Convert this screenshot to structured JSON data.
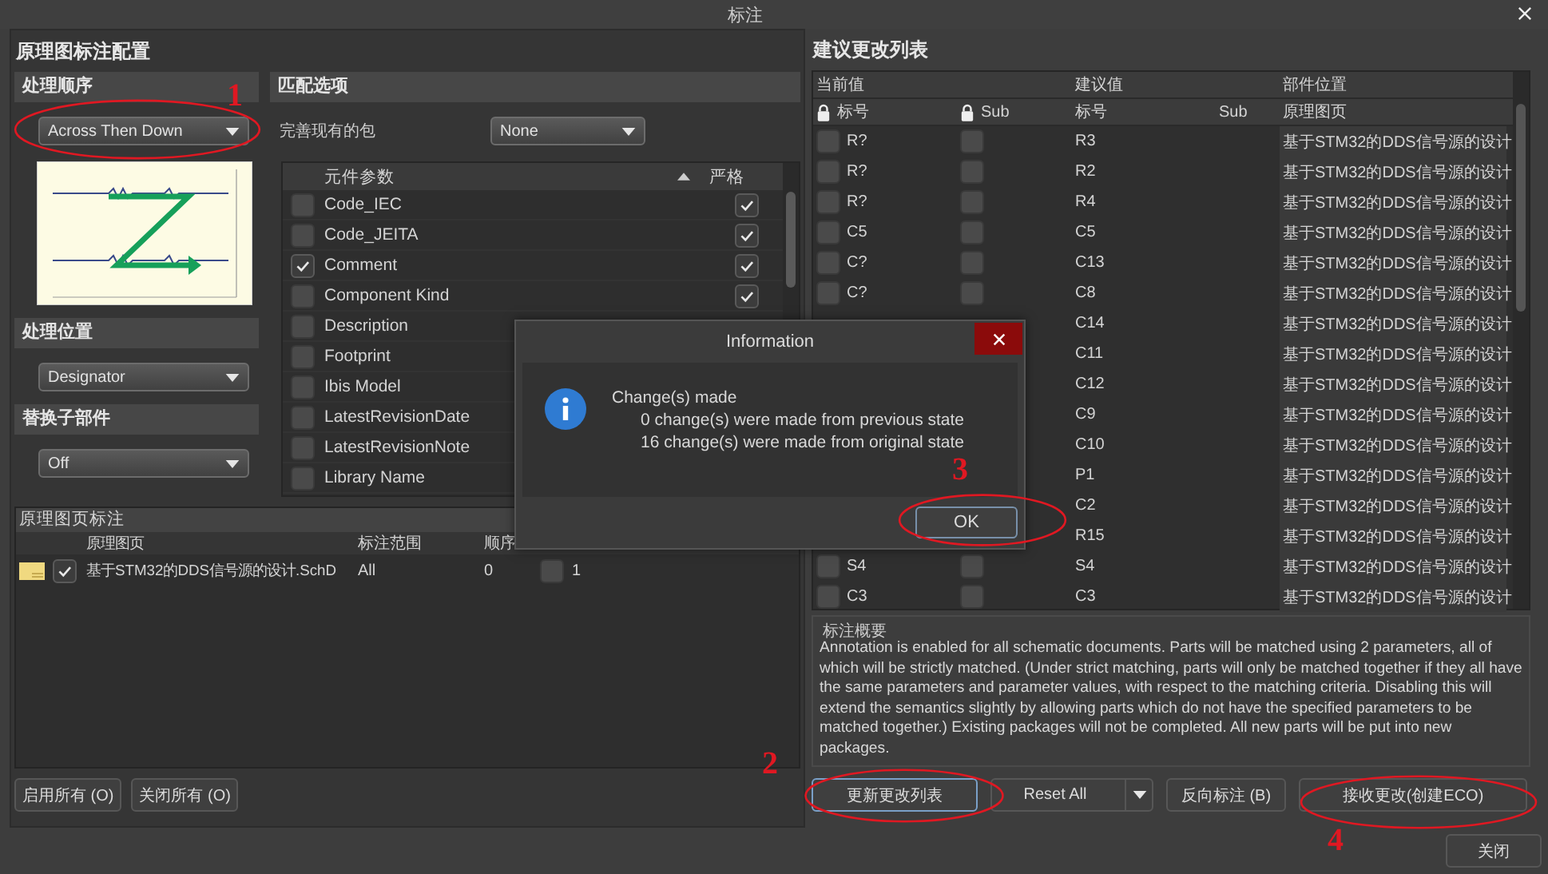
{
  "window": {
    "title": "标注"
  },
  "config": {
    "title": "原理图标注配置",
    "sections": [
      {
        "header": "处理顺序",
        "value": "Across Then Down"
      },
      {
        "header": "处理位置",
        "value": "Designator"
      },
      {
        "header": "替换子部件",
        "value": "Off"
      }
    ],
    "matching": {
      "header": "匹配选项",
      "complete_label": "完善现有的包",
      "complete_value": "None",
      "columns": [
        "元件参数",
        "严格"
      ],
      "params": [
        {
          "name": "Code_IEC",
          "checked": false,
          "strict": true
        },
        {
          "name": "Code_JEITA",
          "checked": false,
          "strict": true
        },
        {
          "name": "Comment",
          "checked": true,
          "strict": true
        },
        {
          "name": "Component Kind",
          "checked": false,
          "strict": true
        },
        {
          "name": "Description",
          "checked": false
        },
        {
          "name": "Footprint",
          "checked": false
        },
        {
          "name": "Ibis Model",
          "checked": false
        },
        {
          "name": "LatestRevisionDate",
          "checked": false
        },
        {
          "name": "LatestRevisionNote",
          "checked": false
        },
        {
          "name": "Library Name",
          "checked": false
        }
      ]
    }
  },
  "sheets": {
    "title": "原理图页标注",
    "columns": [
      "原理图页",
      "标注范围",
      "顺序"
    ],
    "rows": [
      {
        "enabled": true,
        "sheet": "基于STM32的DDS信号源的设计.SchD",
        "scope": "All",
        "order": "0",
        "start_checked": false,
        "start": "1"
      }
    ],
    "buttons": [
      "启用所有 (O)",
      "关闭所有 (O)"
    ]
  },
  "changes": {
    "title": "建议更改列表",
    "groups": [
      "当前值",
      "建议值",
      "部件位置"
    ],
    "columns": [
      "标号",
      "Sub",
      "标号",
      "Sub",
      "原理图页"
    ],
    "rows": [
      {
        "locked": false,
        "sub_locked": false,
        "current": "R?",
        "proposed": "R3",
        "sheet": "基于STM32的DDS信号源的设计"
      },
      {
        "locked": false,
        "sub_locked": false,
        "current": "R?",
        "proposed": "R2",
        "sheet": "基于STM32的DDS信号源的设计"
      },
      {
        "locked": false,
        "sub_locked": false,
        "current": "R?",
        "proposed": "R4",
        "sheet": "基于STM32的DDS信号源的设计"
      },
      {
        "locked": false,
        "sub_locked": false,
        "current": "C5",
        "proposed": "C5",
        "sheet": "基于STM32的DDS信号源的设计"
      },
      {
        "locked": false,
        "sub_locked": false,
        "current": "C?",
        "proposed": "C13",
        "sheet": "基于STM32的DDS信号源的设计"
      },
      {
        "locked": false,
        "sub_locked": false,
        "current": "C?",
        "proposed": "C8",
        "sheet": "基于STM32的DDS信号源的设计"
      },
      {
        "proposed": "C14",
        "sheet": "基于STM32的DDS信号源的设计"
      },
      {
        "proposed": "C11",
        "sheet": "基于STM32的DDS信号源的设计"
      },
      {
        "proposed": "C12",
        "sheet": "基于STM32的DDS信号源的设计"
      },
      {
        "proposed": "C9",
        "sheet": "基于STM32的DDS信号源的设计"
      },
      {
        "proposed": "C10",
        "sheet": "基于STM32的DDS信号源的设计"
      },
      {
        "proposed": "P1",
        "sheet": "基于STM32的DDS信号源的设计"
      },
      {
        "proposed": "C2",
        "sheet": "基于STM32的DDS信号源的设计"
      },
      {
        "proposed": "R15",
        "sheet": "基于STM32的DDS信号源的设计"
      },
      {
        "locked": false,
        "sub_locked": false,
        "current": "S4",
        "proposed": "S4",
        "sheet": "基于STM32的DDS信号源的设计"
      },
      {
        "locked": false,
        "sub_locked": false,
        "current": "C3",
        "proposed": "C3",
        "sheet": "基于STM32的DDS信号源的设计"
      }
    ]
  },
  "summary": {
    "title": "标注概要",
    "text": "Annotation is enabled for all schematic documents. Parts will be matched using 2 parameters, all of which will be strictly matched. (Under strict matching, parts will only be matched together if they all have the same parameters and parameter values, with respect to the matching criteria. Disabling this will extend the semantics slightly by allowing parts which do not have the specified parameters to be matched together.) Existing packages will not be completed. All new parts will be put into new packages."
  },
  "actions": [
    {
      "label": "更新更改列表",
      "kind": "plain",
      "focused": true
    },
    {
      "label": "Reset All",
      "kind": "split",
      "focused": false
    },
    {
      "label": "反向标注 (B)",
      "kind": "plain",
      "focused": false
    },
    {
      "label": "接收更改(创建ECO)",
      "kind": "plain",
      "focused": false
    }
  ],
  "close_button": "关闭",
  "dialog": {
    "title": "Information",
    "heading": "Change(s) made",
    "lines": [
      "0 change(s) were made from previous state",
      "16 change(s) were made from original state"
    ],
    "ok": "OK"
  },
  "annotations": [
    {
      "text": "1"
    },
    {
      "text": "2"
    },
    {
      "text": "3"
    },
    {
      "text": "4"
    }
  ]
}
